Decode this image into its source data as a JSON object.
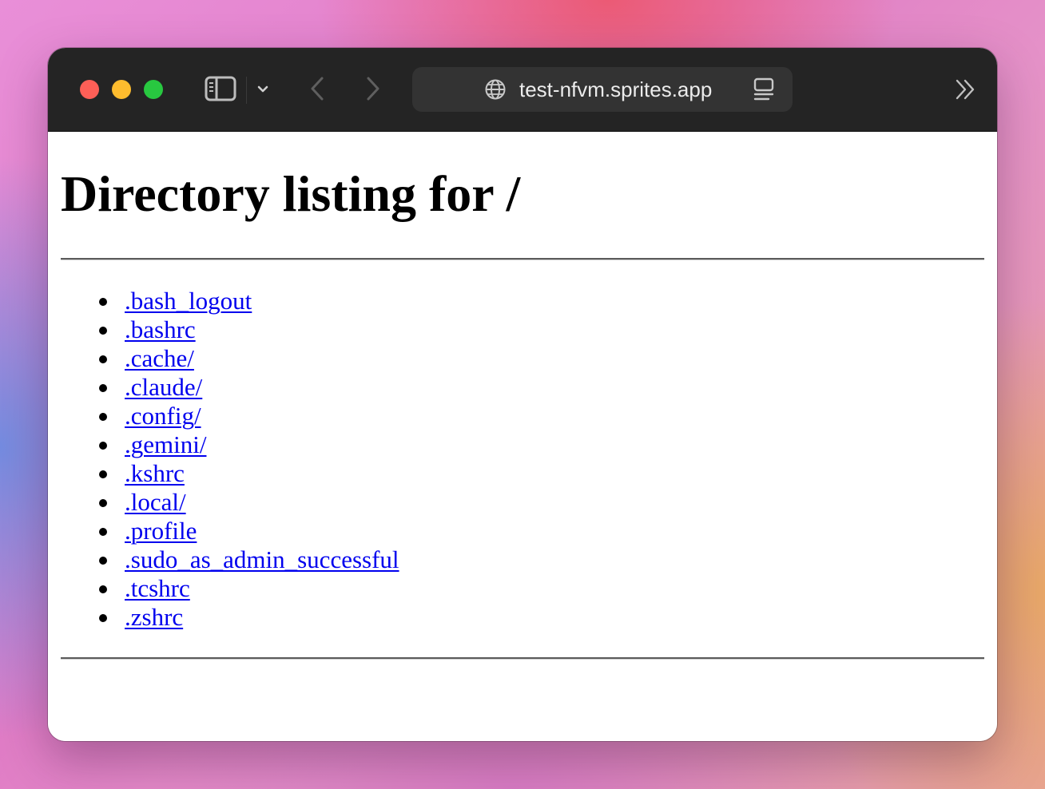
{
  "browser": {
    "url": "test-nfvm.sprites.app",
    "icons": {
      "sidebar": "sidebar-icon",
      "sidebar_menu": "chevron-down-icon",
      "back": "chevron-left-icon",
      "forward": "chevron-right-icon",
      "site": "globe-icon",
      "reader": "reader-mode-icon",
      "overflow": "double-chevron-right-icon"
    },
    "traffic_light_colors": [
      "#fe5f57",
      "#febc2e",
      "#28c840"
    ]
  },
  "page": {
    "heading": "Directory listing for /",
    "link_color": "#0000ee",
    "entries": [
      ".bash_logout",
      ".bashrc",
      ".cache/",
      ".claude/",
      ".config/",
      ".gemini/",
      ".kshrc",
      ".local/",
      ".profile",
      ".sudo_as_admin_successful",
      ".tcshrc",
      ".zshrc"
    ]
  }
}
